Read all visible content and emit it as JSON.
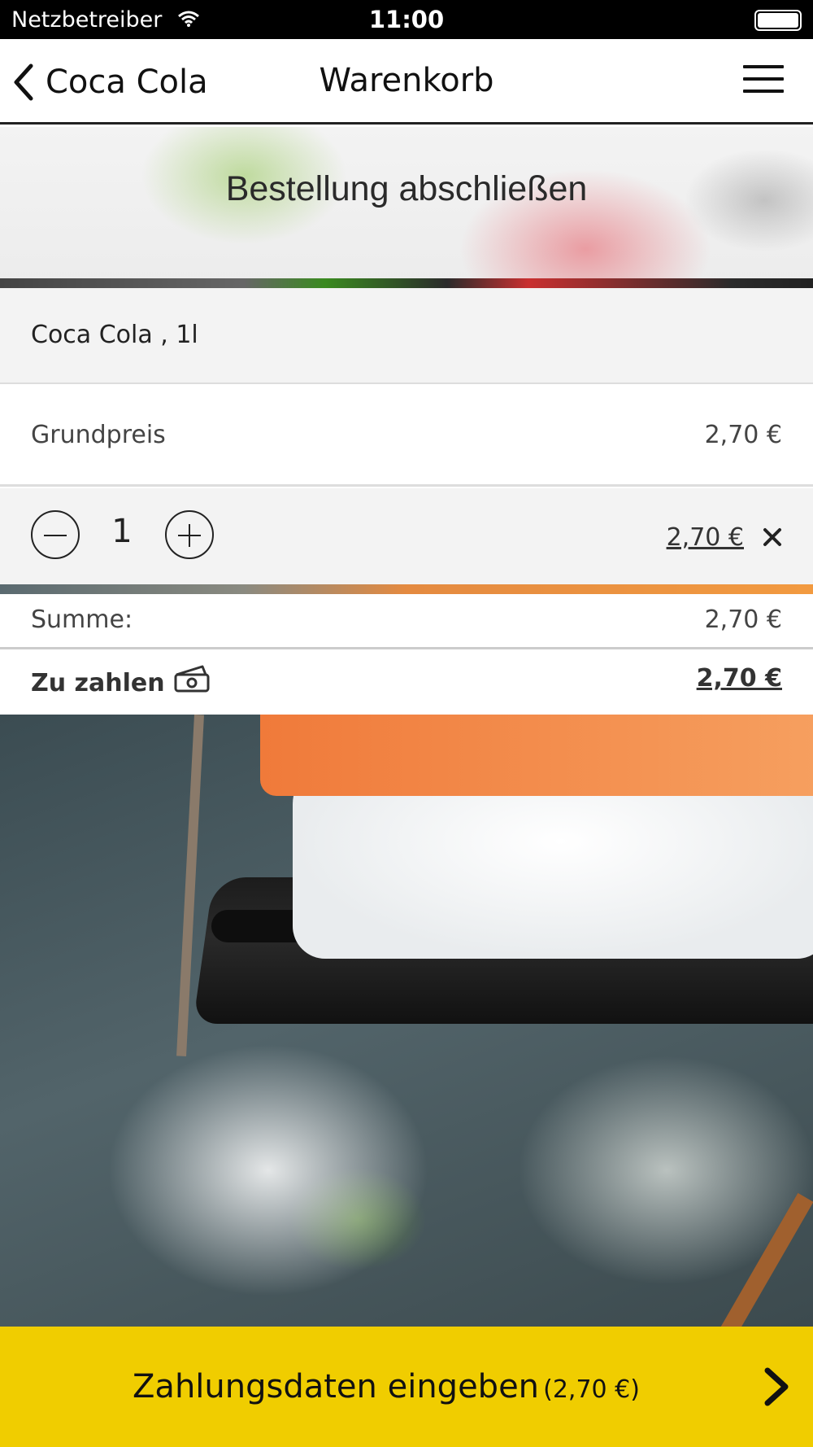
{
  "status_bar": {
    "carrier": "Netzbetreiber",
    "time": "11:00"
  },
  "nav": {
    "back_label": "Coca Cola",
    "title": "Warenkorb"
  },
  "hero": {
    "heading": "Bestellung abschließen"
  },
  "cart": {
    "item_name": "Coca Cola , 1l",
    "base_price_label": "Grundpreis",
    "base_price_value": "2,70 €",
    "quantity": "1",
    "line_price": "2,70 €"
  },
  "totals": {
    "sum_label": "Summe:",
    "sum_value": "2,70 €",
    "pay_label": "Zu zahlen",
    "pay_value": "2,70 €"
  },
  "cta": {
    "label": "Zahlungsdaten eingeben",
    "amount": "(2,70 €)"
  },
  "colors": {
    "accent": "#f0cd00",
    "status_bar": "#000000",
    "row_gray": "#f3f3f3"
  },
  "icons": [
    "wifi-icon",
    "battery-icon",
    "chevron-left-icon",
    "hamburger-menu-icon",
    "minus-icon",
    "plus-icon",
    "close-icon",
    "cash-icon",
    "chevron-right-icon"
  ]
}
